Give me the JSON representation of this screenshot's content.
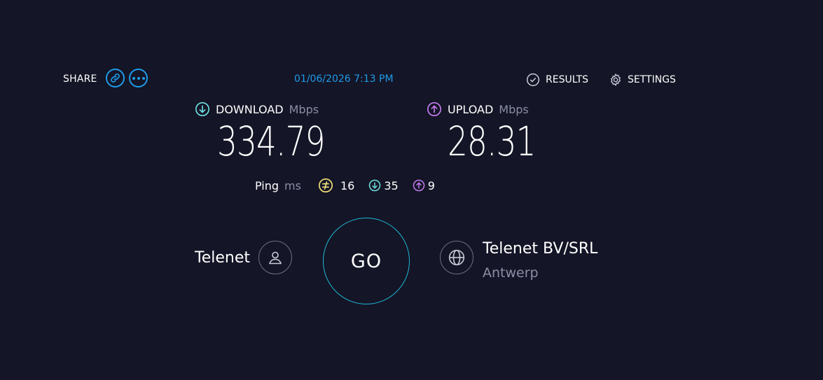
{
  "header": {
    "share_label": "SHARE",
    "timestamp": "01/06/2026 7:13 PM",
    "results_label": "RESULTS",
    "settings_label": "SETTINGS"
  },
  "download": {
    "label": "DOWNLOAD",
    "unit": "Mbps",
    "value": "334.79"
  },
  "upload": {
    "label": "UPLOAD",
    "unit": "Mbps",
    "value": "28.31"
  },
  "ping": {
    "label": "Ping",
    "unit": "ms",
    "idle": "16",
    "download": "35",
    "upload": "9"
  },
  "isp": {
    "name": "Telenet"
  },
  "go_label": "GO",
  "server": {
    "name": "Telenet BV/SRL",
    "location": "Antwerp"
  },
  "colors": {
    "background": "#141526",
    "accent_blue": "#1e9be9",
    "download_teal": "#6ee0e0",
    "upload_purple": "#c57bf0",
    "ping_yellow": "#f2e27a",
    "go_ring": "#1fb8d6",
    "muted_text": "#8b8ea6"
  },
  "icons": {
    "share_link": "link-icon",
    "share_more": "more-dots-icon",
    "results": "check-circle-icon",
    "settings": "gear-icon",
    "download": "arrow-down-circle-icon",
    "upload": "arrow-up-circle-icon",
    "ping_idle": "idle-latency-icon",
    "isp": "person-icon",
    "server": "globe-icon"
  }
}
